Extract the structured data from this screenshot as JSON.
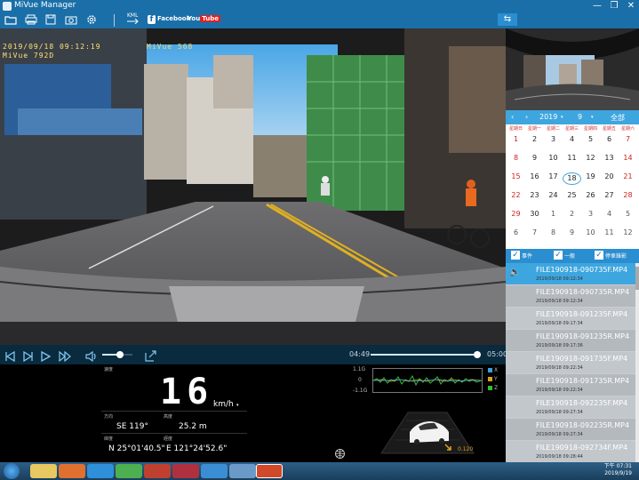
{
  "window": {
    "title": "MiVue Manager",
    "minimize": "—",
    "restore": "❐",
    "close": "✕"
  },
  "toolbar": {
    "kml_label": "KML",
    "facebook_label": "Facebook",
    "youtube_you": "You",
    "youtube_tube": "Tube"
  },
  "video": {
    "osd_timestamp": "2019/09/18 09:12:19",
    "osd_model": "MiVue 792D",
    "osd_extra": "MiVue 568"
  },
  "player": {
    "current_time": "04:49",
    "total_time": "05:00",
    "progress": 0.97,
    "volume": 0.6
  },
  "dashboard": {
    "speed_label": "速度",
    "speed_value": "16",
    "speed_unit": "km/h",
    "heading_label": "方向",
    "heading_value": "SE 119°",
    "altitude_label": "高度",
    "altitude_value": "25.2  m",
    "latitude_label": "緯度",
    "latitude_value": "N 25°01'40.5\"",
    "longitude_label": "經度",
    "longitude_value": "E 121°24'52.6\""
  },
  "gsensor": {
    "scale_top": "1.1G",
    "scale_mid": "0",
    "scale_bottom": "-1.1G",
    "axis_x": "X",
    "axis_y": "Y",
    "axis_z": "Z",
    "g_value": "0.120",
    "colors": {
      "x": "#3aa0e0",
      "y": "#e0a020",
      "z": "#30c030"
    }
  },
  "calendar": {
    "year": "2019",
    "month": "9",
    "all_label": "全部",
    "weekdays": [
      "星期日",
      "星期一",
      "星期二",
      "星期三",
      "星期四",
      "星期五",
      "星期六"
    ],
    "weeks": [
      [
        "1",
        "2",
        "3",
        "4",
        "5",
        "6",
        "7"
      ],
      [
        "8",
        "9",
        "10",
        "11",
        "12",
        "13",
        "14"
      ],
      [
        "15",
        "16",
        "17",
        "18",
        "19",
        "20",
        "21"
      ],
      [
        "22",
        "23",
        "24",
        "25",
        "26",
        "27",
        "28"
      ],
      [
        "29",
        "30",
        "1",
        "2",
        "3",
        "4",
        "5"
      ],
      [
        "6",
        "7",
        "8",
        "9",
        "10",
        "11",
        "12"
      ]
    ],
    "selected_day": "18"
  },
  "filters": [
    {
      "label": "事件",
      "checked": true
    },
    {
      "label": "一般",
      "checked": true
    },
    {
      "label": "停車錄影",
      "checked": true
    }
  ],
  "files": [
    {
      "name": "FILE190918-090735F.MP4",
      "date": "2019/09/18   09:12:34"
    },
    {
      "name": "FILE190918-090735R.MP4",
      "date": "2019/09/18   09:12:34"
    },
    {
      "name": "FILE190918-091235F.MP4",
      "date": "2019/09/18   09:17:34"
    },
    {
      "name": "FILE190918-091235R.MP4",
      "date": "2019/09/18   09:17:36"
    },
    {
      "name": "FILE190918-091735F.MP4",
      "date": "2019/09/18   09:22:34"
    },
    {
      "name": "FILE190918-091735R.MP4",
      "date": "2019/09/18   09:22:34"
    },
    {
      "name": "FILE190918-092235F.MP4",
      "date": "2019/09/18   09:27:34"
    },
    {
      "name": "FILE190918-092235R.MP4",
      "date": "2019/09/18   09:27:34"
    },
    {
      "name": "FILE190918-092734F.MP4",
      "date": "2019/09/18   09:28:44"
    }
  ],
  "taskbar": {
    "time": "下午 07:31",
    "date": "2019/9/19"
  }
}
